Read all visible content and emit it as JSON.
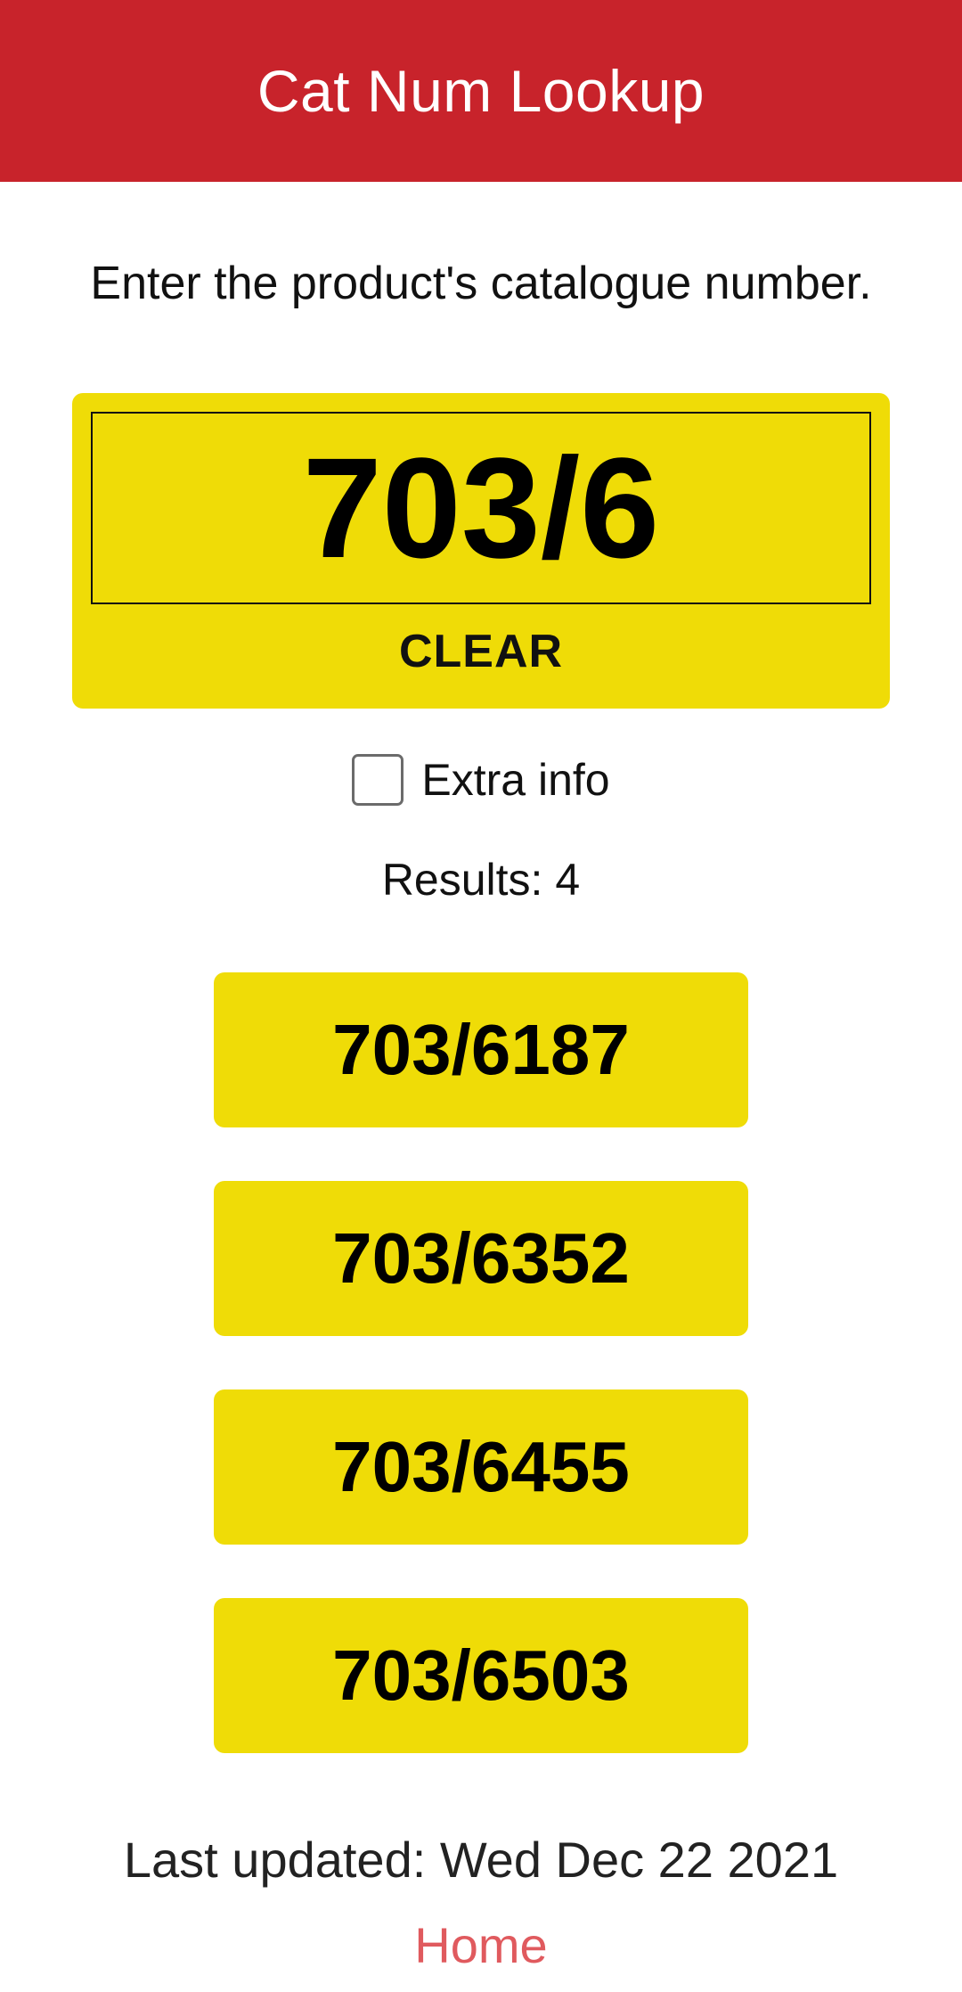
{
  "header": {
    "title": "Cat Num Lookup"
  },
  "instruction": "Enter the product's catalogue number.",
  "search": {
    "value": "703/6",
    "clear_label": "CLEAR"
  },
  "extra_info": {
    "label": "Extra info",
    "checked": false
  },
  "results": {
    "label": "Results: 4",
    "items": [
      "703/6187",
      "703/6352",
      "703/6455",
      "703/6503"
    ]
  },
  "footer": {
    "last_updated": "Last updated: Wed Dec 22 2021",
    "home_link": "Home"
  },
  "colors": {
    "header_bg": "#c8232b",
    "accent_yellow": "#efdc07",
    "link_red": "#e05a5e"
  }
}
